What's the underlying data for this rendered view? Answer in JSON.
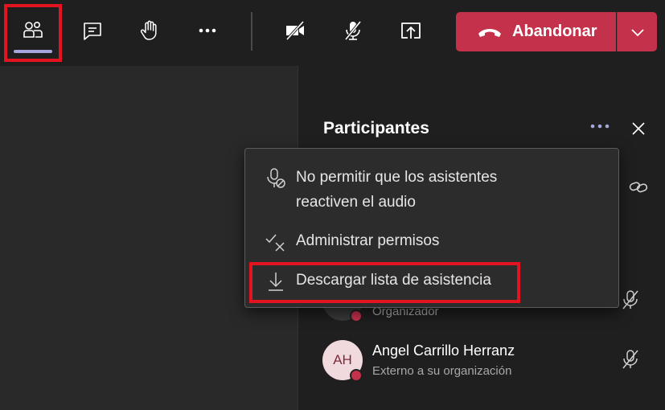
{
  "toolbar": {
    "buttons": [
      {
        "icon": "people-icon",
        "active": true
      },
      {
        "icon": "chat-icon"
      },
      {
        "icon": "raise-hand-icon"
      },
      {
        "icon": "more-icon"
      },
      {
        "icon": "camera-off-icon"
      },
      {
        "icon": "mic-off-icon"
      },
      {
        "icon": "share-screen-icon"
      }
    ],
    "leave_label": "Abandonar",
    "leave_color": "#c4314b",
    "active_underline_color": "#a6a7dc",
    "highlight_color": "#e3141f"
  },
  "panel": {
    "title": "Participantes",
    "participants": [
      {
        "initials": "",
        "name": "",
        "subtitle": "Organizador",
        "muted": true
      },
      {
        "initials": "AH",
        "name": "Angel Carrillo Herranz",
        "subtitle": "Externo a su organización",
        "muted": true
      }
    ]
  },
  "menu": {
    "items": [
      {
        "label_line1": "No permitir que los asistentes",
        "label_line2": "reactiven el audio",
        "icon": "mic-block-icon"
      },
      {
        "label": "Administrar permisos",
        "icon": "permissions-icon"
      },
      {
        "label": "Descargar lista de asistencia",
        "icon": "download-icon",
        "highlighted": true
      }
    ]
  }
}
